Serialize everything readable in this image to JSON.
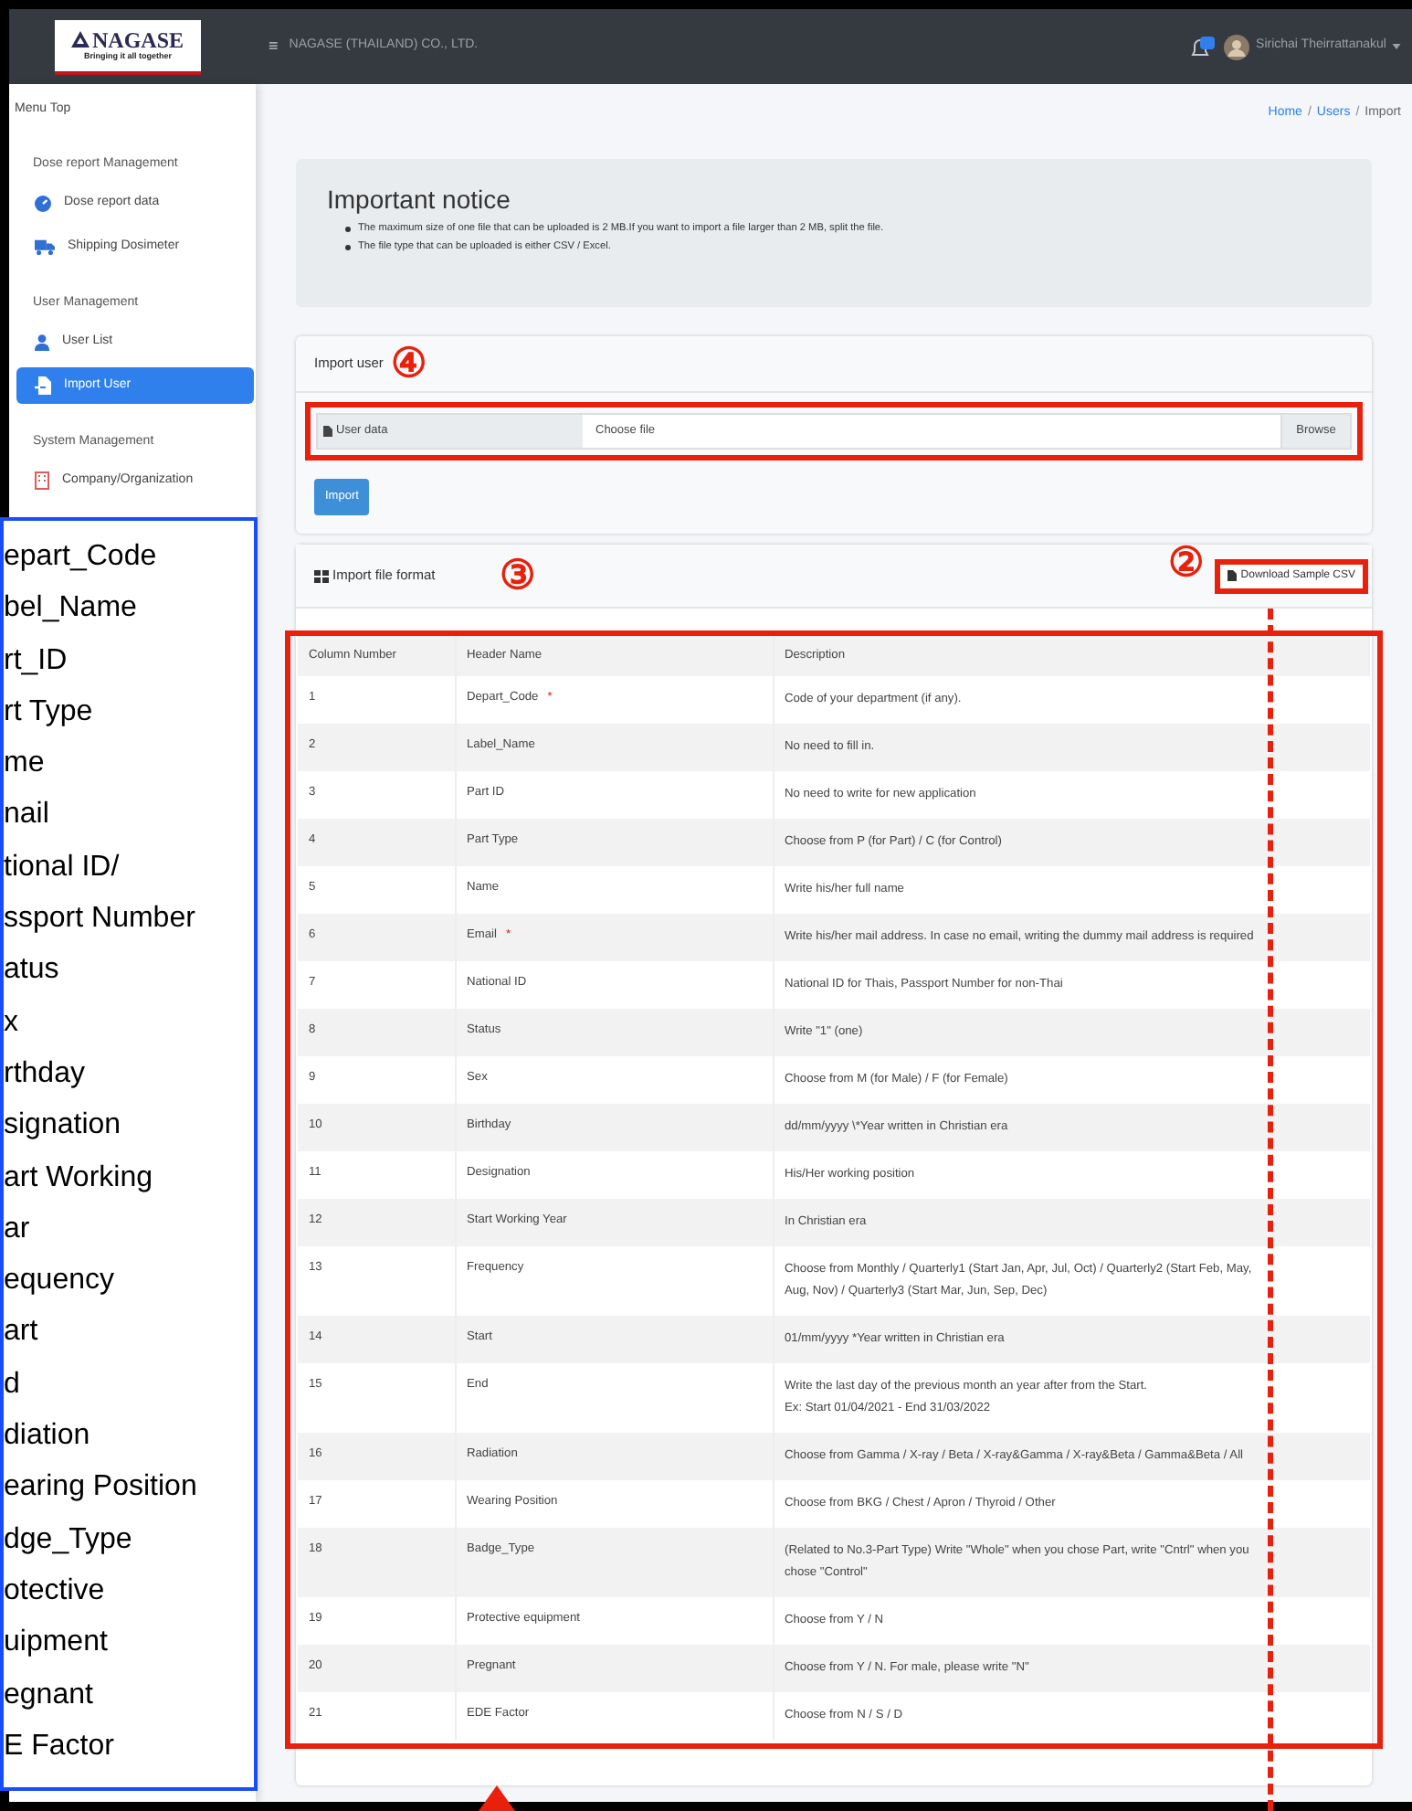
{
  "logo": {
    "name": "NAGASE",
    "tagline": "Bringing it all together"
  },
  "header": {
    "menu_glyph": "≡",
    "company": "NAGASE (THAILAND) CO., LTD.",
    "user": "Sirichai Theirrattanakul"
  },
  "sidebar": {
    "title": "Menu Top",
    "sections": [
      {
        "heading": "Dose report Management",
        "items": [
          {
            "label": "Dose report data",
            "selected": false
          },
          {
            "label": "Shipping Dosimeter",
            "selected": false
          }
        ]
      },
      {
        "heading": "User Management",
        "items": [
          {
            "label": "User List",
            "selected": false
          },
          {
            "label": "Import User",
            "selected": true
          }
        ]
      },
      {
        "heading": "System Management",
        "items": [
          {
            "label": "Company/Organization",
            "selected": false
          }
        ]
      }
    ]
  },
  "breadcrumb": [
    {
      "label": "Home",
      "link": true
    },
    {
      "separator": "/",
      "label": "Users",
      "link": true
    },
    {
      "separator": "/",
      "label": "Import",
      "link": false
    }
  ],
  "notice": {
    "title": "Important notice",
    "items": [
      "The maximum size of one file that can be uploaded is 2 MB.If you want to import a file larger than 2 MB, split the file.",
      "The file type that can be uploaded is either CSV / Excel."
    ]
  },
  "import_user": {
    "title": "Import user",
    "marker": "④",
    "file_label": "User data",
    "placeholder": "Choose file",
    "browse": "Browse",
    "submit": "Import"
  },
  "format": {
    "title": "Import file format",
    "marker": "③",
    "download_marker": "②",
    "download": "Download Sample CSV",
    "columns": [
      "Column Number",
      "Header Name",
      "Description"
    ],
    "rows": [
      {
        "number": "1",
        "header": "Depart_Code",
        "mark": "*",
        "description": "Code of your department (if any)."
      },
      {
        "number": "2",
        "header": "Label_Name",
        "description": "No need to fill in."
      },
      {
        "number": "3",
        "header": "Part ID",
        "description": "No need to write for new application"
      },
      {
        "number": "4",
        "header": "Part Type",
        "description": "Choose from P (for Part) / C (for Control)"
      },
      {
        "number": "5",
        "header": "Name",
        "description": "Write his/her full name"
      },
      {
        "number": "6",
        "header": "Email",
        "mark": "*",
        "description": "Write his/her mail address. In case no email, writing the dummy mail address is required"
      },
      {
        "number": "7",
        "header": "National ID",
        "description": "National ID for Thais, Passport Number for non-Thai"
      },
      {
        "number": "8",
        "header": "Status",
        "description": "Write \"1\" (one)"
      },
      {
        "number": "9",
        "header": "Sex",
        "description": "Choose from M (for Male) / F (for Female)"
      },
      {
        "number": "10",
        "header": "Birthday",
        "description": "dd/mm/yyyy \\*Year written in Christian era"
      },
      {
        "number": "11",
        "header": "Designation",
        "description": "His/Her working position"
      },
      {
        "number": "12",
        "header": "Start Working Year",
        "description": "In Christian era"
      },
      {
        "number": "13",
        "header": "Frequency",
        "description": "Choose from Monthly / Quarterly1 (Start Jan, Apr, Jul, Oct) / Quarterly2 (Start Feb, May, Aug, Nov) / Quarterly3 (Start Mar, Jun, Sep, Dec)"
      },
      {
        "number": "14",
        "header": "Start",
        "description": "01/mm/yyyy *Year written in Christian era"
      },
      {
        "number": "15",
        "header": "End",
        "description": "Write the last day of the previous month an year after from the Start.\nEx: Start 01/04/2021 - End 31/03/2022"
      },
      {
        "number": "16",
        "header": "Radiation",
        "description": "Choose from Gamma / X-ray / Beta / X-ray&Gamma / X-ray&Beta / Gamma&Beta / All"
      },
      {
        "number": "17",
        "header": "Wearing Position",
        "description": "Choose from BKG / Chest / Apron / Thyroid / Other"
      },
      {
        "number": "18",
        "header": "Badge_Type",
        "description": "(Related to No.3-Part Type) Write \"Whole\" when you chose Part, write \"Cntrl\" when you chose \"Control\""
      },
      {
        "number": "19",
        "header": "Protective equipment",
        "description": "Choose from Y / N"
      },
      {
        "number": "20",
        "header": "Pregnant",
        "description": "Choose from Y / N. For male, please write \"N\""
      },
      {
        "number": "21",
        "header": "EDE Factor",
        "description": "Choose from N / S / D"
      }
    ]
  },
  "side_list": [
    "epart_Code",
    "bel_Name",
    "rt_ID",
    "rt Type",
    "me",
    "nail",
    "tional ID/",
    "ssport Number",
    "atus",
    "x",
    "rthday",
    "signation",
    "art Working",
    "ar",
    "equency",
    "art",
    "d",
    "diation",
    "earing Position",
    "dge_Type",
    "otective",
    "uipment",
    "egnant",
    "E Factor"
  ]
}
